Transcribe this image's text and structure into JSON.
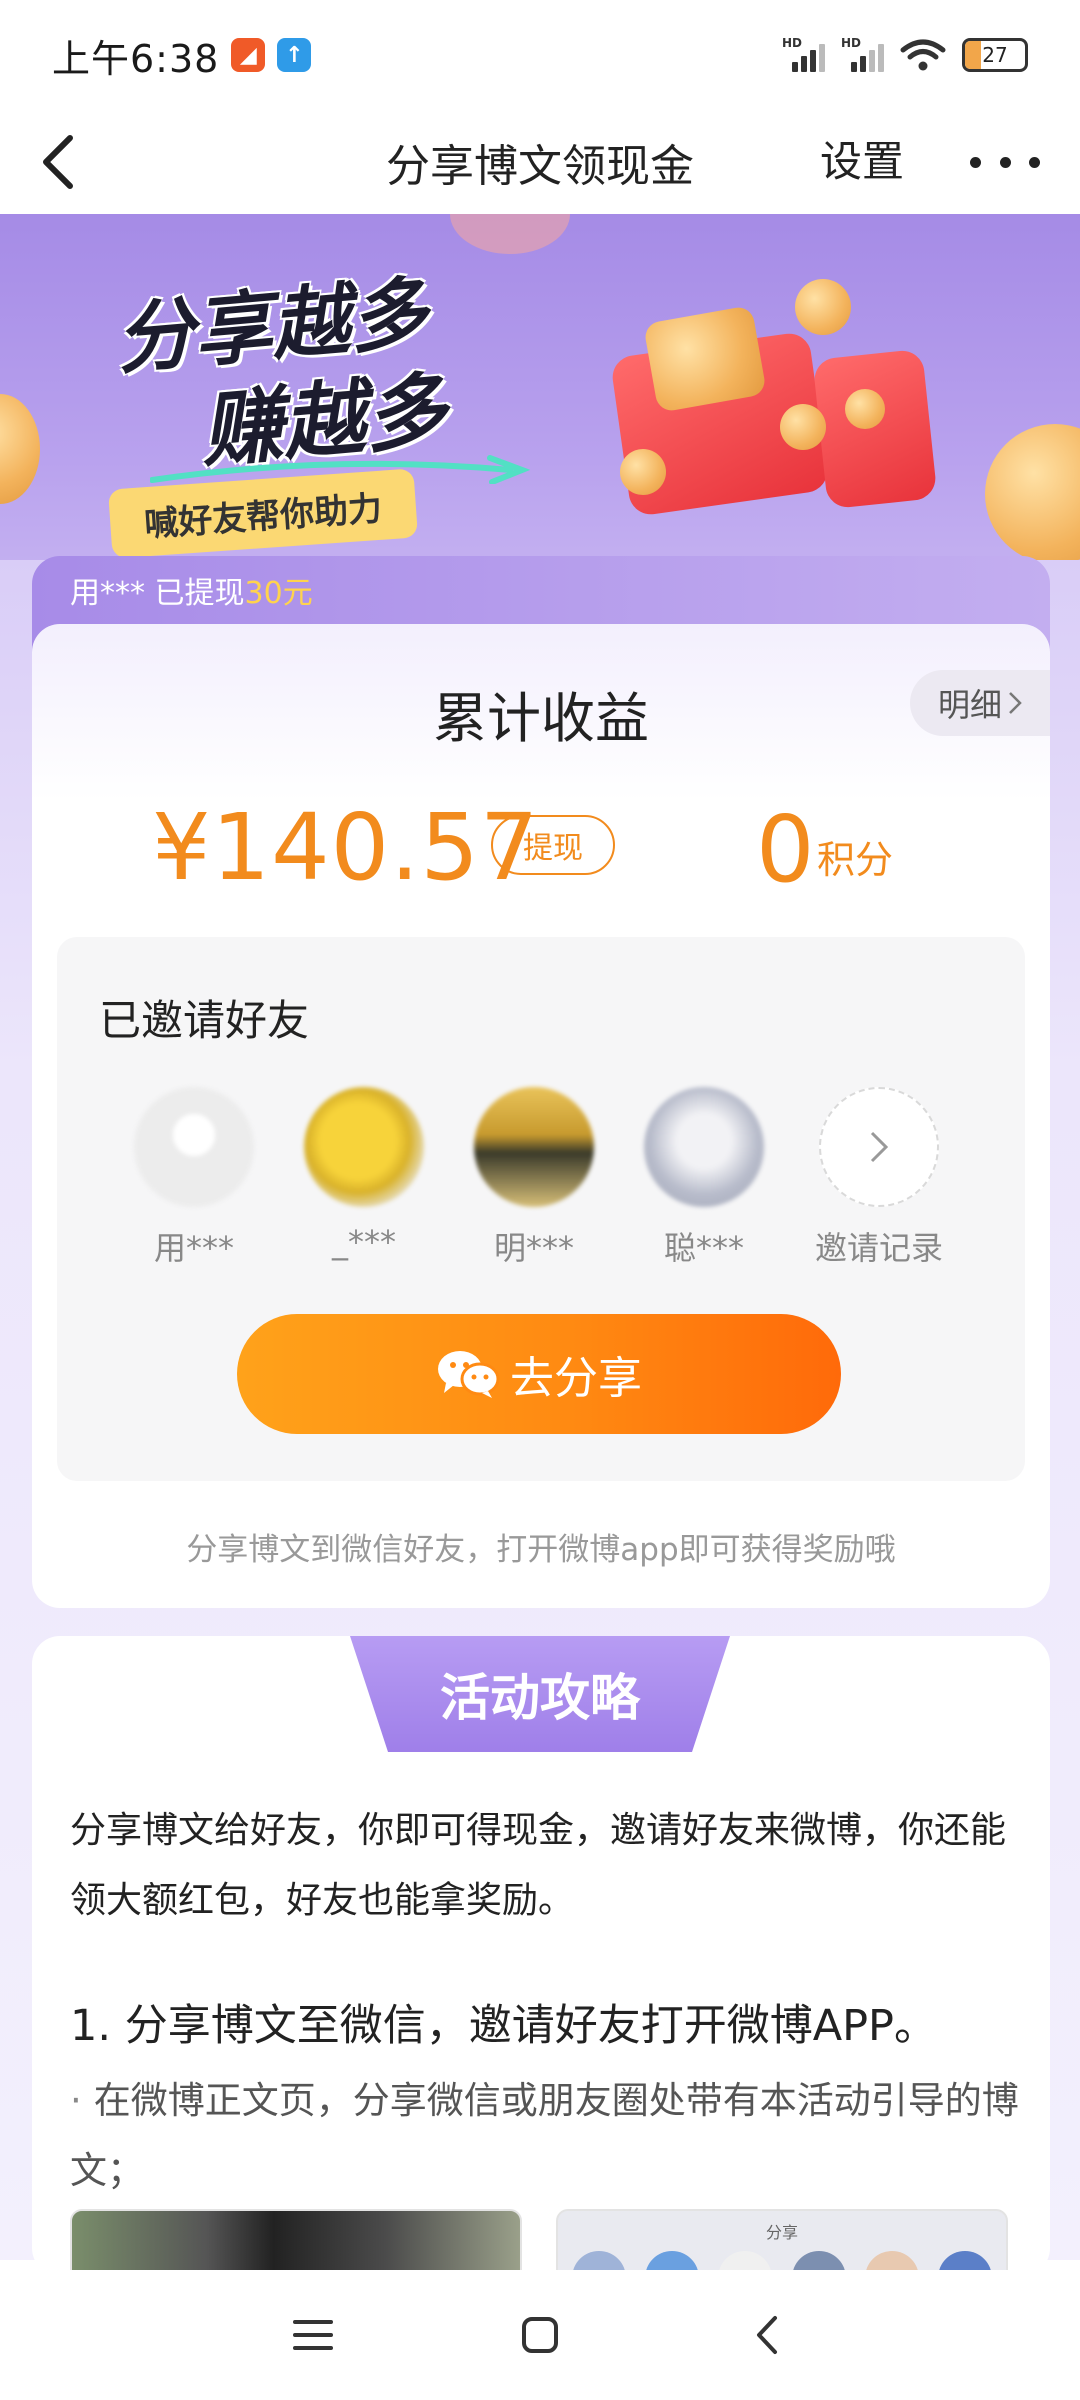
{
  "status_bar": {
    "time": "上午6:38",
    "battery": "27",
    "battery_level": 0.27,
    "signal_label": "HD"
  },
  "header": {
    "title": "分享博文领现金",
    "settings_label": "设置"
  },
  "banner": {
    "slogan_line1": "分享越多",
    "slogan_line2": "赚越多",
    "tag": "喊好友帮你助力"
  },
  "earnings": {
    "notice_prefix": "用*** 已提现",
    "notice_amount": "30元",
    "title": "累计收益",
    "detail_label": "明细",
    "amount": "¥140.57",
    "withdraw_label": "提现",
    "points_value": "0",
    "points_label": "积分"
  },
  "friends": {
    "title": "已邀请好友",
    "list": [
      {
        "name": "用***"
      },
      {
        "name": "_***"
      },
      {
        "name": "明***"
      },
      {
        "name": "聪***"
      }
    ],
    "invite_record_label": "邀请记录",
    "share_button": "去分享",
    "tip": "分享博文到微信好友，打开微博app即可获得奖励哦"
  },
  "guide": {
    "tab_label": "活动攻略",
    "intro": "分享博文给好友，你即可得现金，邀请好友来微博，你还能领大额红包，好友也能拿奖励。",
    "step1": "1. 分享博文至微信，邀请好友打开微博APP。",
    "step1_bullet": "在微博正文页，分享微信或朋友圈处带有本活动引导的博文；",
    "screenshot_label": "分享"
  },
  "colors": {
    "accent_orange": "#f28b1d",
    "purple": "#a78be8",
    "notice_gold": "#ffd34d"
  },
  "icons": [
    "back-icon",
    "more-icon",
    "chevron-right-icon",
    "wechat-icon",
    "menu-icon",
    "home-icon",
    "back-nav-icon"
  ]
}
